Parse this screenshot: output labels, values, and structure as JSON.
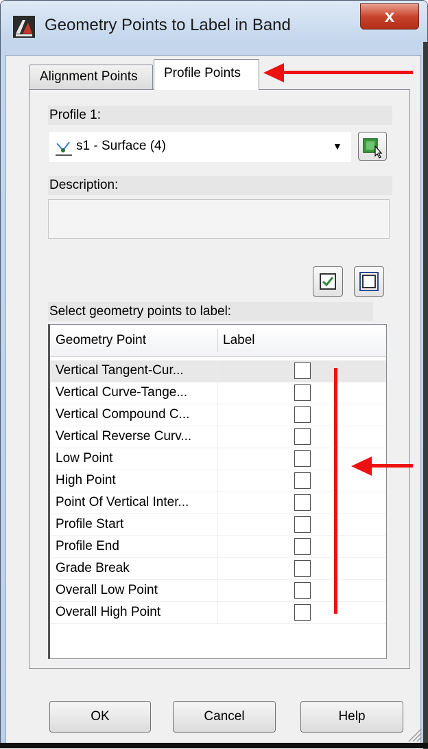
{
  "window": {
    "title": "Geometry Points to Label in Band",
    "close_label": "x"
  },
  "tabs": [
    {
      "label": "Alignment Points",
      "active": false
    },
    {
      "label": "Profile Points",
      "active": true
    }
  ],
  "profile": {
    "label": "Profile 1:",
    "selected": "s1 - Surface (4)"
  },
  "description": {
    "label": "Description:",
    "value": ""
  },
  "grid": {
    "prompt": "Select geometry points to label:",
    "columns": [
      "Geometry Point",
      "Label"
    ],
    "rows": [
      {
        "name": "Vertical Tangent-Cur...",
        "checked": false
      },
      {
        "name": "Vertical Curve-Tange...",
        "checked": false
      },
      {
        "name": "Vertical Compound C...",
        "checked": false
      },
      {
        "name": "Vertical Reverse Curv...",
        "checked": false
      },
      {
        "name": "Low Point",
        "checked": false
      },
      {
        "name": "High Point",
        "checked": false
      },
      {
        "name": "Point Of Vertical Inter...",
        "checked": false
      },
      {
        "name": "Profile Start",
        "checked": false
      },
      {
        "name": "Profile End",
        "checked": false
      },
      {
        "name": "Grade Break",
        "checked": false
      },
      {
        "name": "Overall Low Point",
        "checked": false
      },
      {
        "name": "Overall High Point",
        "checked": false
      }
    ]
  },
  "buttons": {
    "ok": "OK",
    "cancel": "Cancel",
    "help": "Help"
  },
  "colors": {
    "annotation": "#ee1111",
    "check_green": "#2e8b3a"
  }
}
